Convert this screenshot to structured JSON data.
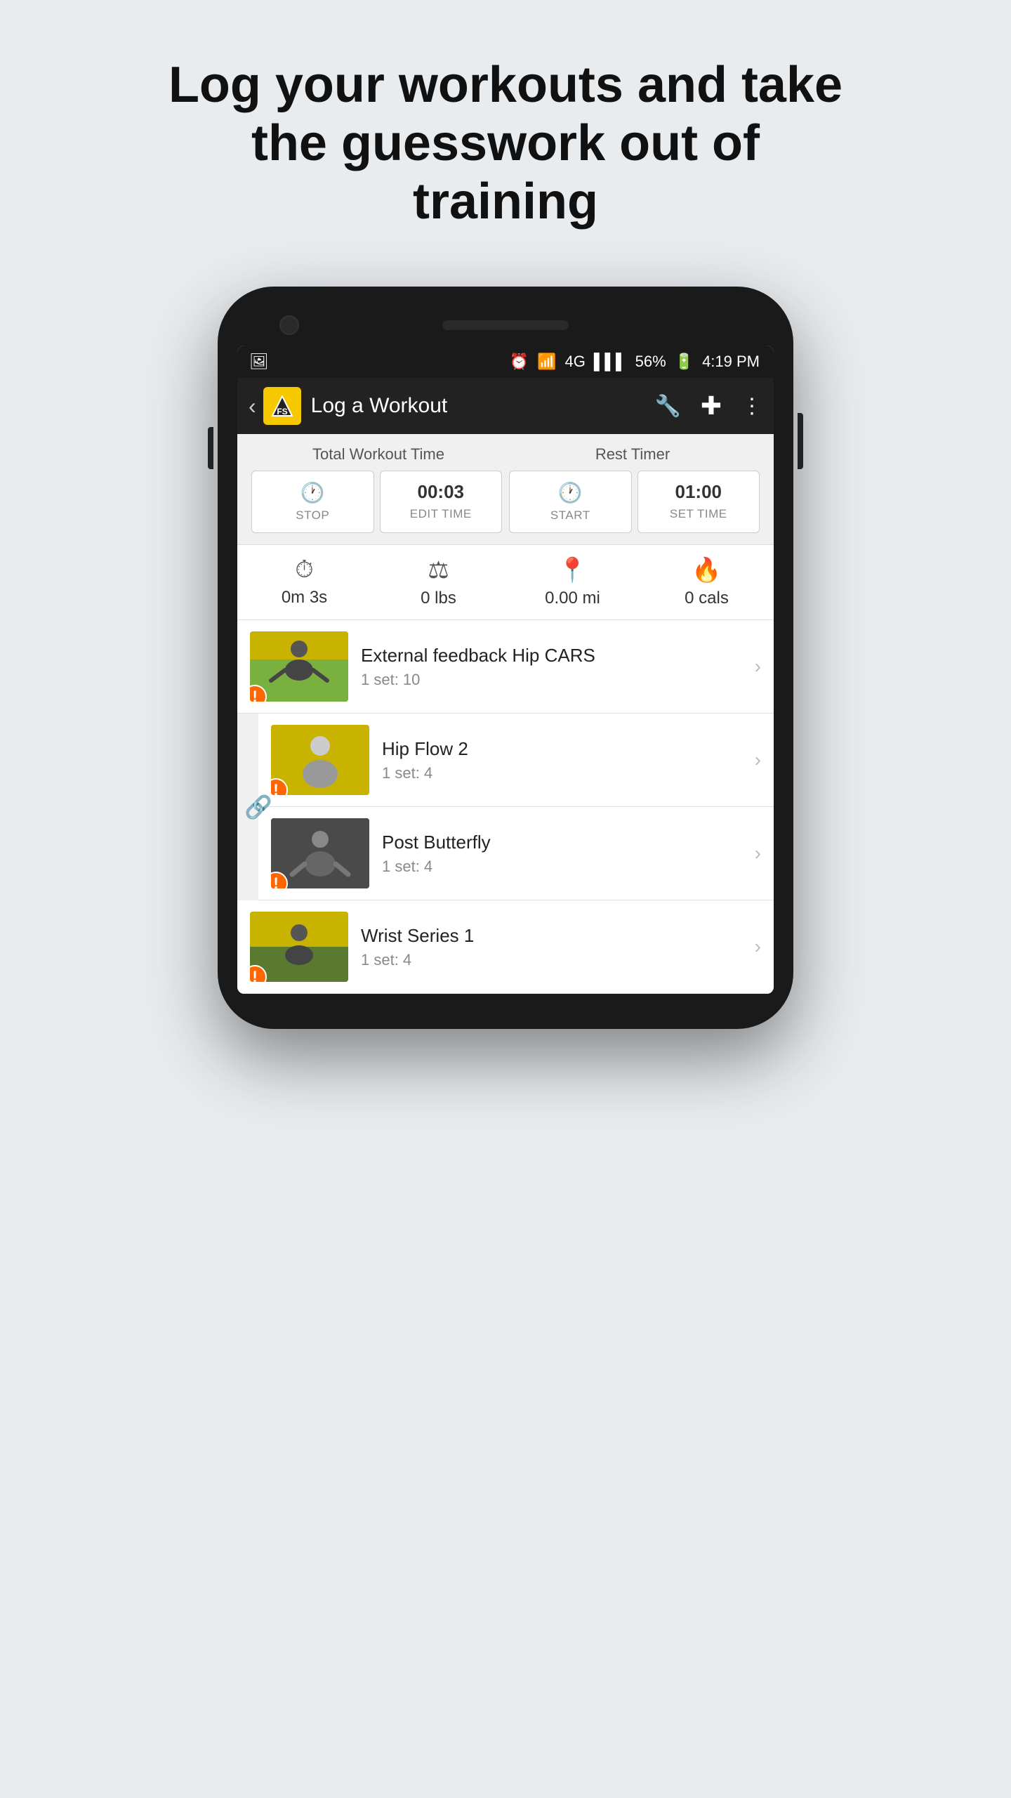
{
  "headline": {
    "line1": "Log your workouts and take",
    "line2": "the guesswork out of training"
  },
  "status_bar": {
    "time": "4:19 PM",
    "battery": "56%",
    "signal": "4G"
  },
  "toolbar": {
    "title": "Log a Workout",
    "back_label": "‹"
  },
  "total_workout": {
    "header": "Total Workout Time",
    "stop_label": "STOP",
    "edit_time_value": "00:03",
    "edit_time_label": "EDIT TIME"
  },
  "rest_timer": {
    "header": "Rest Timer",
    "start_label": "START",
    "set_time_value": "01:00",
    "set_time_label": "SET TIME"
  },
  "stats": {
    "duration": "0m  3s",
    "weight": "0 lbs",
    "distance": "0.00 mi",
    "calories": "0 cals"
  },
  "exercises": [
    {
      "name": "External feedback Hip CARS",
      "sets": "1 set: 10",
      "has_error": true,
      "thumb_style": "yellow"
    },
    {
      "name": "Hip Flow 2",
      "sets": "1 set: 4",
      "has_error": true,
      "thumb_style": "yellow",
      "grouped": true
    },
    {
      "name": "Post Butterfly",
      "sets": "1 set: 4",
      "has_error": true,
      "thumb_style": "dark",
      "grouped": true
    },
    {
      "name": "Wrist Series 1",
      "sets": "1 set: 4",
      "has_error": true,
      "thumb_style": "yellow"
    }
  ]
}
